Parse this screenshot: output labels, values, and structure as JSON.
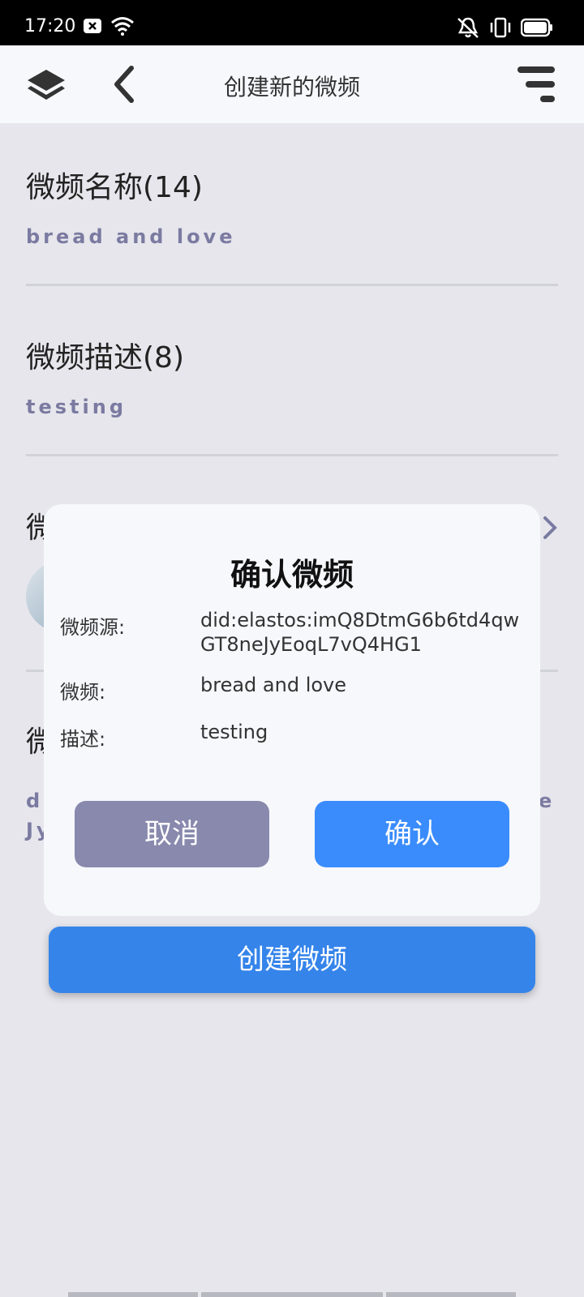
{
  "status_bar": {
    "time": "17:20"
  },
  "header": {
    "title": "创建新的微频"
  },
  "form": {
    "name_label": "微频名称(14)",
    "name_value": "bread and love",
    "desc_label": "微频描述(8)",
    "desc_value": "testing",
    "avatar_label_partial": "微",
    "did_label_partial": "微",
    "did_partial_line1": "d",
    "did_partial_line2": "Jy",
    "did_partial_right": "e"
  },
  "create_button": {
    "label": "创建微频"
  },
  "dialog": {
    "title": "确认微频",
    "source_label": "微频源:",
    "source_value": "did:elastos:imQ8DtmG6b6td4qwGT8neJyEoqL7vQ4HG1",
    "channel_label": "微频:",
    "channel_value": "bread and love",
    "desc_label": "描述:",
    "desc_value": "testing",
    "cancel_label": "取消",
    "confirm_label": "确认"
  },
  "colors": {
    "accent_blue": "#3584ea",
    "confirm_blue": "#3a8cfc",
    "cancel_gray": "#8889ad",
    "value_purple": "#7b7aa1"
  }
}
